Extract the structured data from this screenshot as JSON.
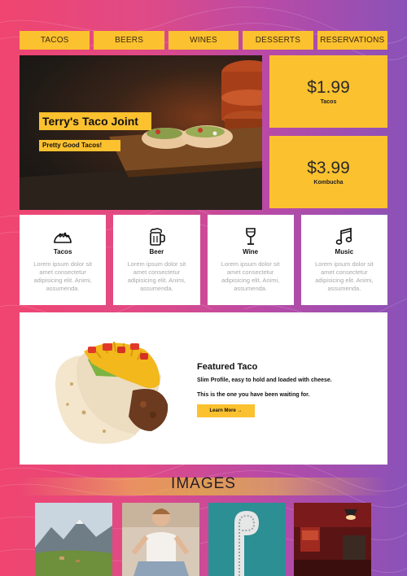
{
  "nav": {
    "items": [
      {
        "label": "TACOS"
      },
      {
        "label": "BEERS"
      },
      {
        "label": "WINES"
      },
      {
        "label": "DESSERTS"
      },
      {
        "label": "RESERVATIONS"
      }
    ]
  },
  "hero": {
    "title": "Terry's Taco Joint",
    "subtitle": "Pretty Good Tacos!"
  },
  "prices": [
    {
      "amount": "$1.99",
      "label": "Tacos"
    },
    {
      "amount": "$3.99",
      "label": "Kombucha"
    }
  ],
  "features": [
    {
      "icon": "taco-icon",
      "title": "Tacos",
      "text": "Lorem ipsum dolor sit amet consectetur adipisicing elit. Animi, assumenda."
    },
    {
      "icon": "beer-mug-icon",
      "title": "Beer",
      "text": "Lorem ipsum dolor sit amet consectetur adipisicing elit. Animi, assumenda."
    },
    {
      "icon": "wine-glass-icon",
      "title": "Wine",
      "text": "Lorem ipsum dolor sit amet consectetur adipisicing elit. Animi, assumenda."
    },
    {
      "icon": "music-note-icon",
      "title": "Music",
      "text": "Lorem ipsum dolor sit amet consectetur adipisicing elit. Animi, assumenda."
    }
  ],
  "featured": {
    "title": "Featured Taco",
    "line1": "Slim Profile, easy to hold and loaded with cheese.",
    "line2": "This is the one you have been waiting for.",
    "button": "Learn More →"
  },
  "images": {
    "title": "IMAGES"
  },
  "colors": {
    "accent": "#fcc12e",
    "gradient_left": "#f0456f",
    "gradient_right": "#8a52b8"
  }
}
